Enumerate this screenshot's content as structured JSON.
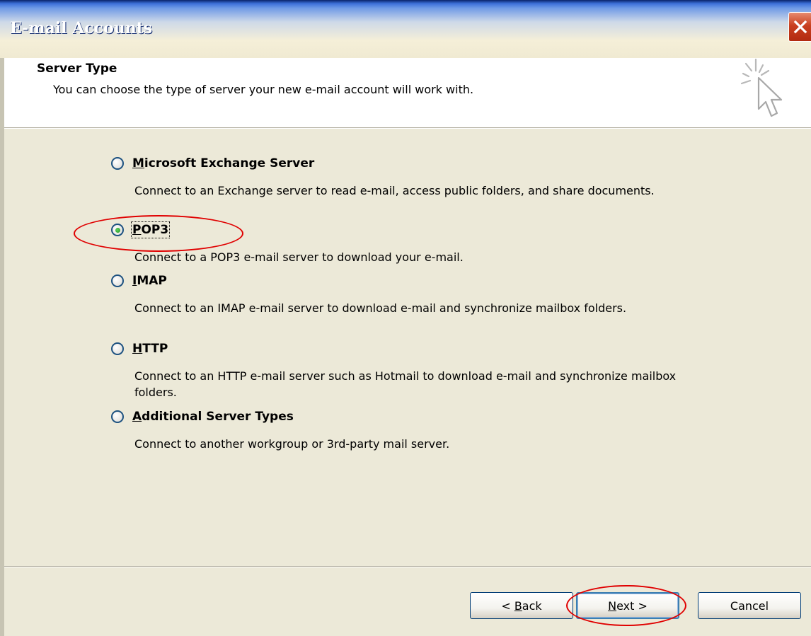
{
  "window": {
    "title": "E-mail Accounts",
    "close_label": "Close"
  },
  "header": {
    "title": "Server Type",
    "description": "You can choose the type of server your new e-mail account will work with."
  },
  "options": [
    {
      "label": "Microsoft Exchange Server",
      "mnemonic": "M",
      "description": "Connect to an Exchange server to read e-mail, access public folders, and share documents.",
      "selected": false
    },
    {
      "label": "POP3",
      "mnemonic": "P",
      "description": "Connect to a POP3 e-mail server to download your e-mail.",
      "selected": true
    },
    {
      "label": "IMAP",
      "mnemonic": "I",
      "description": "Connect to an IMAP e-mail server to download e-mail and synchronize mailbox folders.",
      "selected": false
    },
    {
      "label": "HTTP",
      "mnemonic": "H",
      "description": "Connect to an HTTP e-mail server such as Hotmail to download e-mail and synchronize mailbox folders.",
      "selected": false
    },
    {
      "label": "Additional Server Types",
      "mnemonic": "A",
      "description": "Connect to another workgroup or 3rd-party mail server.",
      "selected": false
    }
  ],
  "buttons": {
    "back": "< Back",
    "next": "Next >",
    "cancel": "Cancel"
  },
  "colors": {
    "titlebar_text": "#ffffff",
    "dialog_bg": "#ece9d8",
    "header_bg": "#ffffff",
    "close_button": "#c9401f",
    "radio_selected": "#219321",
    "annotation": "#e00000"
  },
  "icons": {
    "close": "close-x-icon",
    "wizard": "cursor-sparkle-icon"
  }
}
